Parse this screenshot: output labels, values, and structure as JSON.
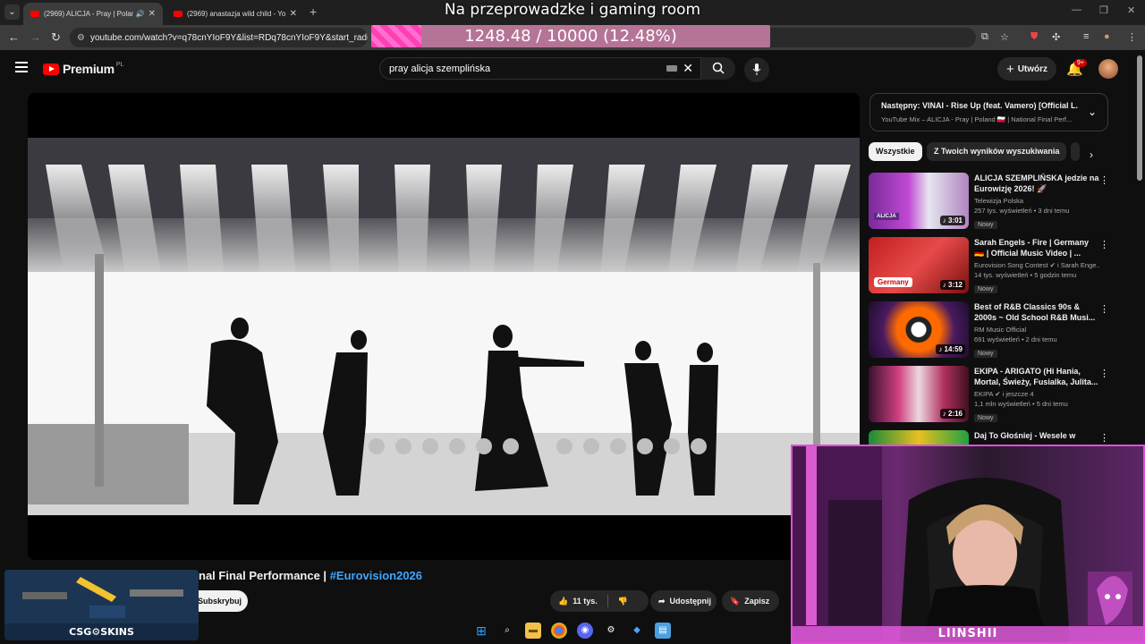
{
  "browser": {
    "tabs": [
      {
        "title": "(2969) ALICJA - Pray | Poland",
        "active": true
      },
      {
        "title": "(2969) anastazja wild child - Yo",
        "active": false
      }
    ],
    "url": "youtube.com/watch?v=q78cnYIoF9Y&list=RDq78cnYIoF9Y&start_radio=1"
  },
  "stream": {
    "title": "Na przeprowadzke i gaming room",
    "goal_text": "1248.48 / 10000 (12.48%)",
    "goal_fraction": 0.1248,
    "webcam_name": "LIINSHII"
  },
  "youtube": {
    "brand": "Premium",
    "region": "PL",
    "search_value": "pray alicja szemplińska",
    "create_label": "Utwórz",
    "notif_badge": "9+",
    "video_title_visible": "nal Final Performance | ",
    "video_hashtag": "#Eurovision2026",
    "subscribe_label": "Subskrybuj",
    "likes": "11 tys.",
    "share_label": "Udostępnij",
    "save_label": "Zapisz",
    "up_next": {
      "title": "Następny: VINAI - Rise Up (feat. Vamero) [Official L...",
      "subtitle": "YouTube Mix – ALICJA - Pray | Poland 🇵🇱 | National Final Perf..."
    },
    "chips": [
      "Wszystkie",
      "Z Twoich wyników wyszukiwania"
    ],
    "recommendations": [
      {
        "title": "ALICJA SZEMPLIŃSKA jedzie na Eurowizję 2026! 🚀",
        "channel": "Telewizja Polska",
        "meta": "257 tys. wyświetleń • 3 dni temu",
        "badge": "Nowy",
        "duration": "3:01"
      },
      {
        "title": "Sarah Engels - Fire | Germany 🇩🇪 | Official Music Video | ...",
        "channel": "Eurovision Song Contest ✔ i Sarah Enge...",
        "meta": "14 tys. wyświetleń • 5 godzin temu",
        "badge": "Nowy",
        "duration": "3:12"
      },
      {
        "title": "Best of R&B Classics 90s & 2000s ~ Old School R&B Musi...",
        "channel": "RM Music Official",
        "meta": "691 wyświetleń • 2 dni temu",
        "badge": "Nowy",
        "duration": "14:59"
      },
      {
        "title": "EKIPA - ARIGATO (Hi Hania, Mortal, Świeży, Fusialka, Julita...",
        "channel": "EKIPA ✔ i jeszcze 4",
        "meta": "1,1 mln wyświetleń • 5 dni temu",
        "badge": "Nowy",
        "duration": "2:16"
      },
      {
        "title": "Daj To Głośniej - Wesele w",
        "channel": "",
        "meta": "",
        "badge": "",
        "duration": ""
      }
    ],
    "thumb_labels": {
      "r1": "ALICJA",
      "r2": "Germany"
    }
  },
  "overlay": {
    "skins_title": "CSG⚙SKINS"
  }
}
